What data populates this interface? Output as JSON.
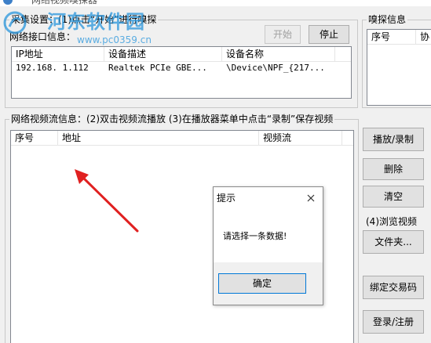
{
  "window": {
    "title": "网络视频嗅探器"
  },
  "capture_group": {
    "title": "采集设置：(1)点击“开始”进行嗅探",
    "interface_label": "网络接口信息：",
    "start_label": "开始",
    "stop_label": "停止",
    "interfaces": {
      "columns": [
        "IP地址",
        "设备描述",
        "设备名称"
      ],
      "rows": [
        [
          "192.168.   1.112",
          "Realtek PCIe GBE...",
          "\\Device\\NPF_{217..."
        ]
      ]
    }
  },
  "sniff_group": {
    "title": "嗅探信息",
    "columns": [
      "序号",
      "协"
    ]
  },
  "stream_group": {
    "title": "网络视频流信息：(2)双击视频流播放 (3)在播放器菜单中点击“录制”保存视频",
    "columns": [
      "序号",
      "地址",
      "视频流"
    ],
    "rows": []
  },
  "actions": {
    "play_record": "播放/录制",
    "delete": "删除",
    "clear": "清空",
    "browse_label": "(4)浏览视频",
    "folder": "文件夹...",
    "bind_code": "绑定交易码",
    "login": "登录/注册"
  },
  "dialog": {
    "title": "提示",
    "message": "请选择一条数据!",
    "ok_label": "确定"
  },
  "watermark": {
    "text": "河东软件园",
    "url": "www.pc0359.cn"
  },
  "colors": {
    "arrow": "#e02020",
    "watermark": "#2896dc",
    "dialog_ok_border": "#0078d7"
  }
}
